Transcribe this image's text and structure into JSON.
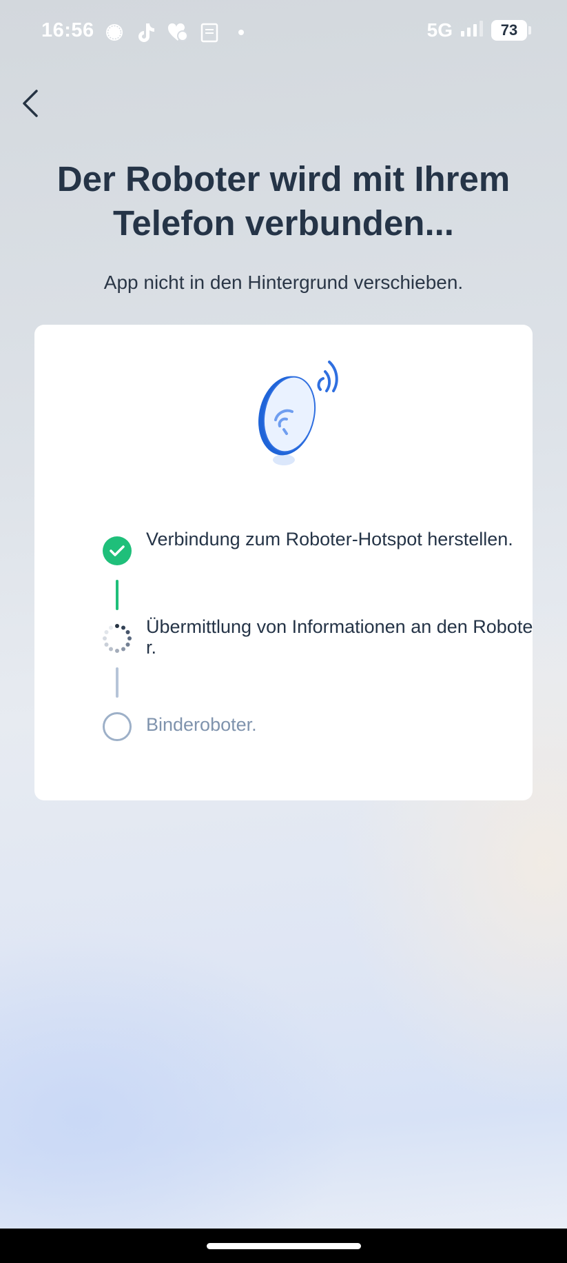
{
  "status_bar": {
    "time": "16:56",
    "network": "5G",
    "battery": "73",
    "icons": [
      "signal-messenger-icon",
      "tiktok-icon",
      "health-app-icon",
      "clipboard-icon",
      "dot-icon",
      "cell-signal-icon",
      "battery-icon"
    ]
  },
  "header": {
    "back_icon": "chevron-left-icon",
    "title": "Der Roboter wird mit Ihrem Telefon verbunden...",
    "subtitle": "App nicht in den Hintergrund verschieben."
  },
  "card": {
    "illustration_icon": "robot-hotspot-wifi-icon",
    "steps": [
      {
        "label": "Verbindung zum Roboter-Hotspot herstellen.",
        "status": "done",
        "icon": "check-circle-icon"
      },
      {
        "label": "Übermittlung von Informationen an den Roboter.",
        "status": "in-progress",
        "icon": "spinner-icon"
      },
      {
        "label": "Binderoboter.",
        "status": "pending",
        "icon": "empty-circle-icon"
      }
    ]
  },
  "colors": {
    "done": "#1fbf7a",
    "pending": "#7f93ad",
    "connector_pending": "#b6c4d8",
    "title": "#253447",
    "accent_blue": "#2f6fe0"
  }
}
